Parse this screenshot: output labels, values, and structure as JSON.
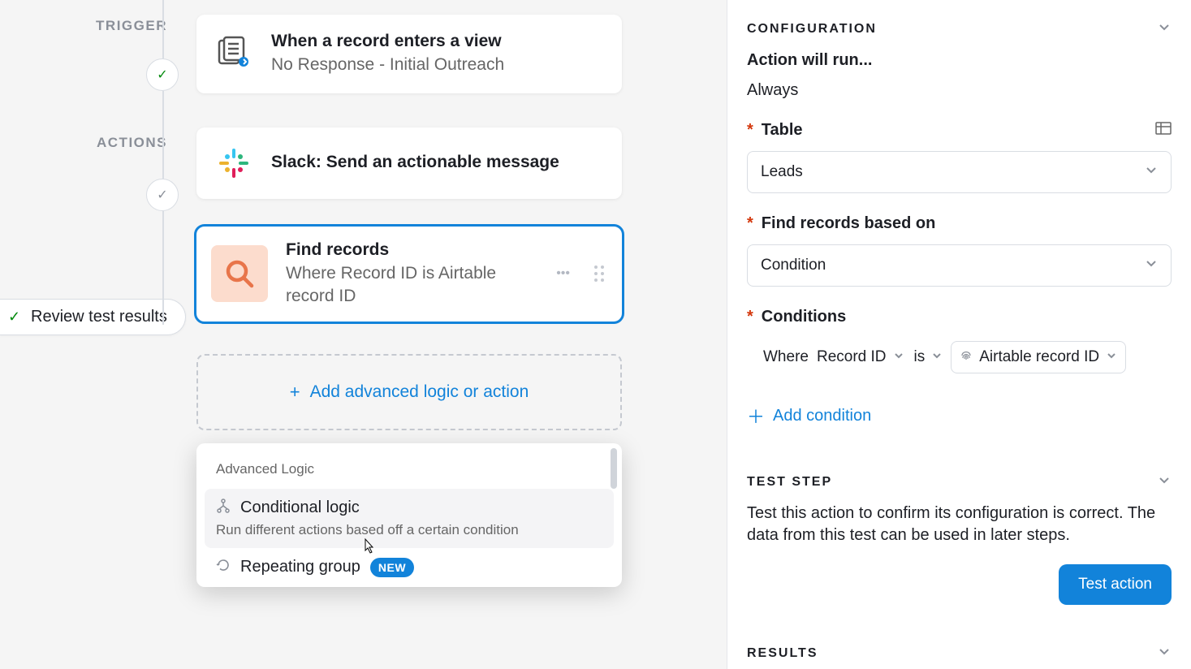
{
  "timeline": {
    "trigger_label": "TRIGGER",
    "actions_label": "ACTIONS",
    "review_test": "Review test results",
    "trigger_card": {
      "title": "When a record enters a view",
      "subtitle": "No Response - Initial Outreach"
    },
    "action_slack": {
      "title": "Slack: Send an actionable message"
    },
    "action_find": {
      "title": "Find records",
      "subtitle": "Where Record ID is Airtable record ID"
    },
    "add_logic": "Add advanced logic or action",
    "dropdown": {
      "header": "Advanced Logic",
      "items": [
        {
          "title": "Conditional logic",
          "desc": "Run different actions based off a certain condition",
          "badge": ""
        },
        {
          "title": "Repeating group",
          "desc": "",
          "badge": "NEW"
        }
      ]
    }
  },
  "config": {
    "header": "CONFIGURATION",
    "runs_label": "Action will run...",
    "runs_value": "Always",
    "table_label": "Table",
    "table_value": "Leads",
    "find_based_label": "Find records based on",
    "find_based_value": "Condition",
    "conditions_label": "Conditions",
    "condition": {
      "where": "Where",
      "field": "Record ID",
      "op": "is",
      "value": "Airtable record ID"
    },
    "add_condition": "Add condition"
  },
  "test": {
    "header": "TEST STEP",
    "desc": "Test this action to confirm its configuration is correct. The data from this test can be used in later steps.",
    "button": "Test action"
  },
  "results": {
    "header": "RESULTS"
  }
}
